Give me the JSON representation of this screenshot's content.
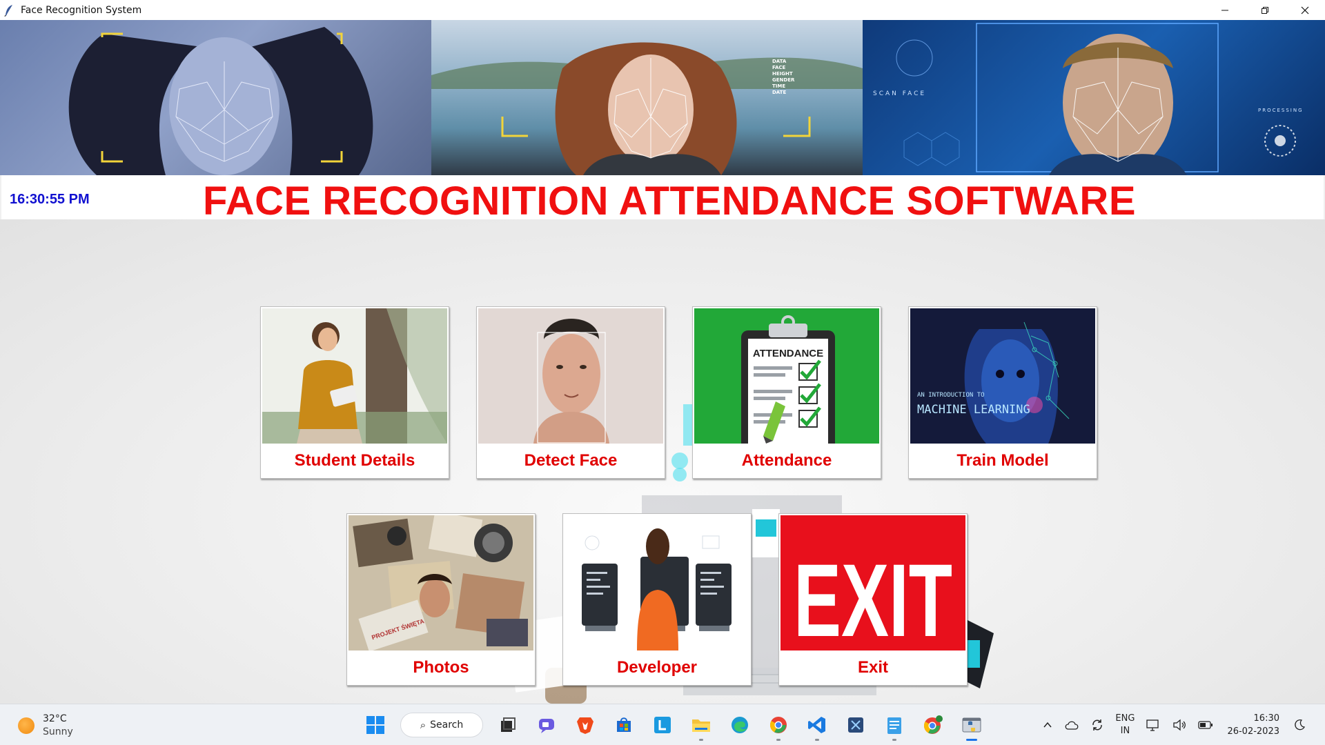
{
  "window": {
    "title": "Face Recognition System"
  },
  "header": {
    "clock": "16:30:55 PM",
    "title": "FACE RECOGNITION ATTENDANCE SOFTWARE",
    "banner": {
      "panel2_labels": [
        "DATA",
        "FACE",
        "HEIGHT",
        "GENDER",
        "TIME",
        "DATE"
      ],
      "panel3_labels": {
        "scan": "SCAN  FACE",
        "processing": "PROCESSING"
      }
    }
  },
  "tiles": [
    {
      "label": "Student Details",
      "icon": "student-photo"
    },
    {
      "label": "Detect Face",
      "icon": "face-scan-photo"
    },
    {
      "label": "Attendance",
      "icon": "attendance-clipboard",
      "image_text": "ATTENDANCE"
    },
    {
      "label": "Train Model",
      "icon": "machine-learning-face",
      "image_text_1": "AN INTRODUCTION TO",
      "image_text_2": "MACHINE LEARNING"
    },
    {
      "label": "Photos",
      "icon": "photo-collage",
      "image_text": "PROJEKT ŚWIĘTA"
    },
    {
      "label": "Developer",
      "icon": "developer-illustration"
    },
    {
      "label": "Exit",
      "icon": "exit-sign",
      "image_text": "EXIT"
    }
  ],
  "taskbar": {
    "weather": {
      "temp": "32°C",
      "condition": "Sunny"
    },
    "search_label": "Search",
    "language": {
      "line1": "ENG",
      "line2": "IN"
    },
    "time": "16:30",
    "date": "26-02-2023"
  },
  "colors": {
    "title_red": "#f01010",
    "clock_blue": "#1010d0",
    "label_red": "#e00000"
  }
}
